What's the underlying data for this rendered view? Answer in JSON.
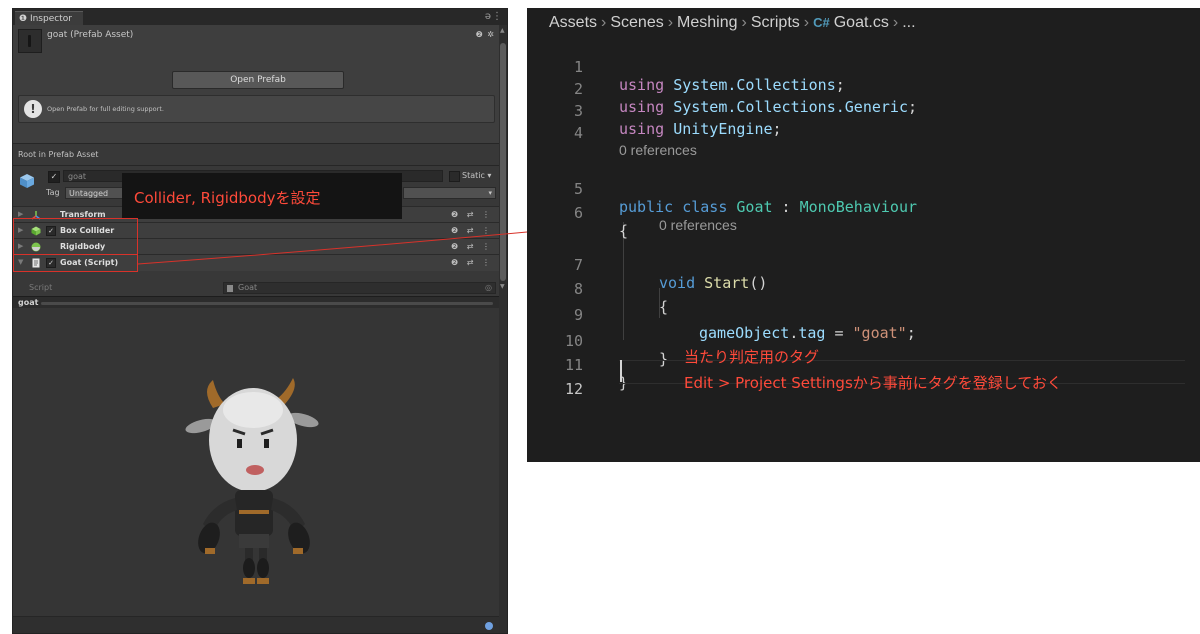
{
  "inspector": {
    "tab_label": "Inspector",
    "tab_icon": "info-icon",
    "lock_icon": "lock-icon",
    "prefab_title": "goat (Prefab Asset)",
    "header_icons": "❷ ✲",
    "open_prefab_label": "Open Prefab",
    "info_text": "Open Prefab for full editing support.",
    "section_label": "Root in Prefab Asset",
    "gameobject_name": "goat",
    "static_label": "Static",
    "tag_label": "Tag",
    "tag_value": "Untagged",
    "components": [
      {
        "name": "Transform",
        "icon": "transform-icon",
        "has_checkbox": false
      },
      {
        "name": "Box Collider",
        "icon": "box-collider-icon",
        "has_checkbox": true
      },
      {
        "name": "Rigidbody",
        "icon": "rigidbody-icon",
        "has_checkbox": false
      },
      {
        "name": "Goat (Script)",
        "icon": "script-icon",
        "has_checkbox": true
      }
    ],
    "script_label": "Script",
    "script_value": "Goat",
    "preview_name": "goat"
  },
  "annotations": {
    "callout_text": "Collider, Rigidbodyを設定",
    "note_line1": "当たり判定用のタグ",
    "note_line2": "Edit > Project Settingsから事前にタグを登録しておく"
  },
  "editor": {
    "breadcrumb": [
      "Assets",
      "Scenes",
      "Meshing",
      "Scripts"
    ],
    "file_icon": "C#",
    "file_name": "Goat.cs",
    "breadcrumb_tail": "...",
    "codelens_text": "0 references",
    "line_numbers": [
      "1",
      "2",
      "3",
      "4",
      "5",
      "6",
      "7",
      "8",
      "9",
      "10",
      "11",
      "12"
    ],
    "code": {
      "l1_kw": "using",
      "l1_ns": "System.Collections",
      "l2_kw": "using",
      "l2_ns": "System.Collections.Generic",
      "l3_kw": "using",
      "l3_ns": "UnityEngine",
      "l5_public": "public",
      "l5_class": "class",
      "l5_name": "Goat",
      "l5_base": "MonoBehaviour",
      "l6": "{",
      "l7_void": "void",
      "l7_fn": "Start",
      "l8": "{",
      "l9_obj": "gameObject",
      "l9_prop": "tag",
      "l9_str": "\"goat\"",
      "l10": "}",
      "l11": "}"
    },
    "colors": {
      "keyword_blue": "#569cd6",
      "keyword_purple": "#c586c0",
      "class": "#4ec9b0",
      "identifier": "#9cdcfe",
      "function": "#dcdcaa",
      "string": "#ce9178",
      "annotation_red": "#ff4a3a"
    }
  }
}
